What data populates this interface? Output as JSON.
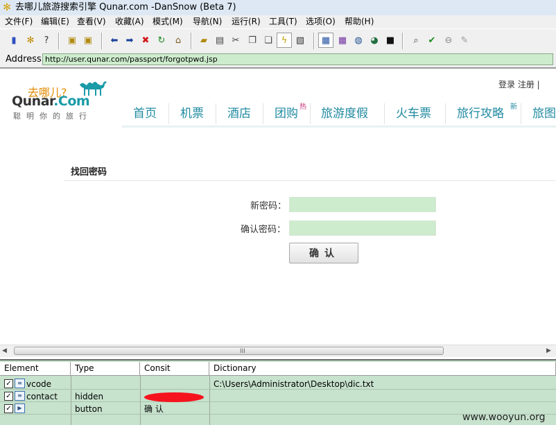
{
  "window": {
    "title": "去哪儿旅游搜索引擎 Qunar.com -DanSnow (Beta 7)"
  },
  "menu": [
    "文件(F)",
    "编辑(E)",
    "查看(V)",
    "收藏(A)",
    "模式(M)",
    "导航(N)",
    "运行(R)",
    "工具(T)",
    "选项(O)",
    "帮助(H)"
  ],
  "address": {
    "label": "Address",
    "url": "http://user.qunar.com/passport/forgotpwd.jsp"
  },
  "site": {
    "logo_cn": "去哪儿?",
    "logo_en_a": "Qunar",
    "logo_en_b": ".Com",
    "slogan": "聪明你的旅行",
    "top_links": "登录  注册  |  ",
    "nav": [
      "首页",
      "机票",
      "酒店",
      "团购",
      "旅游度假",
      "火车票",
      "旅行攻略",
      "旅图"
    ],
    "badge_hot": "热",
    "badge_new": "新"
  },
  "form": {
    "heading": "找回密码",
    "new_password_label": "新密码：",
    "confirm_password_label": "确认密码：",
    "submit_label": "确认"
  },
  "scrollbar": {
    "grip": "III"
  },
  "table": {
    "headers": [
      "Element",
      "Type",
      "Consit",
      "Dictionary"
    ],
    "rows": [
      {
        "element": "vcode",
        "type": "",
        "consit": "",
        "dictionary": "C:\\Users\\Administrator\\Desktop\\dic.txt"
      },
      {
        "element": "contact",
        "type": "hidden",
        "consit": "",
        "dictionary": ""
      },
      {
        "element": "",
        "type": "button",
        "consit": "确 认",
        "dictionary": ""
      }
    ]
  },
  "watermark": "www.wooyun.org",
  "colors": {
    "field_green": "#cdeccd",
    "nav_teal": "#1f8aa0",
    "table_green": "#c7e2cd",
    "redaction": "#f5141d"
  }
}
